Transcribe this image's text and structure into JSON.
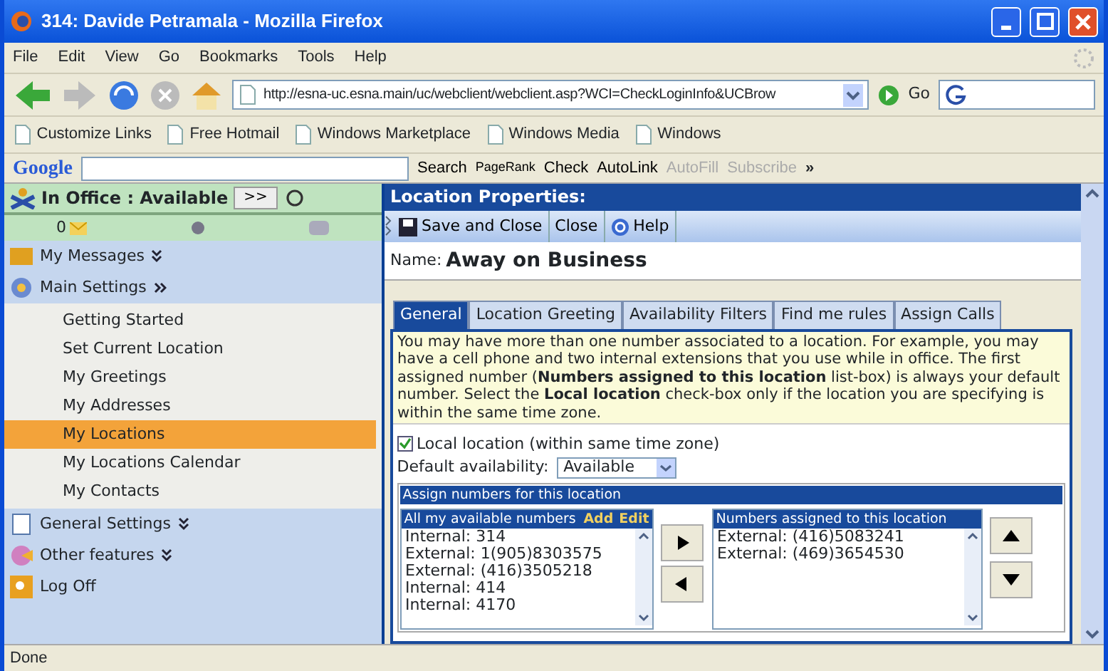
{
  "window": {
    "title": "314: Davide Petramala - Mozilla Firefox"
  },
  "menu": [
    "File",
    "Edit",
    "View",
    "Go",
    "Bookmarks",
    "Tools",
    "Help"
  ],
  "nav": {
    "url": "http://esna-uc.esna.main/uc/webclient/webclient.asp?WCI=CheckLoginInfo&UCBrow",
    "go": "Go"
  },
  "bookmarks": [
    "Customize Links",
    "Free Hotmail",
    "Windows Marketplace",
    "Windows Media",
    "Windows"
  ],
  "google_toolbar": {
    "logo": "Google",
    "items": [
      {
        "label": "Search",
        "disabled": false
      },
      {
        "label": "PageRank",
        "disabled": false
      },
      {
        "label": "Check",
        "disabled": false
      },
      {
        "label": "AutoLink",
        "disabled": false
      },
      {
        "label": "AutoFill",
        "disabled": true
      },
      {
        "label": "Subscribe",
        "disabled": true
      }
    ],
    "more": "»"
  },
  "sidebar": {
    "status": "In Office : Available",
    "status_button": ">>",
    "message_count": "0",
    "sections": [
      {
        "label": "My Messages",
        "expanded": false
      },
      {
        "label": "Main Settings",
        "expanded": true,
        "children": [
          {
            "label": "Getting Started",
            "selected": false
          },
          {
            "label": "Set Current Location",
            "selected": false
          },
          {
            "label": "My Greetings",
            "selected": false
          },
          {
            "label": "My Addresses",
            "selected": false
          },
          {
            "label": "My Locations",
            "selected": true
          },
          {
            "label": "My Locations Calendar",
            "selected": false
          },
          {
            "label": "My Contacts",
            "selected": false
          }
        ]
      },
      {
        "label": "General Settings",
        "expanded": false
      },
      {
        "label": "Other features",
        "expanded": false
      },
      {
        "label": "Log Off"
      }
    ]
  },
  "main": {
    "header": "Location Properties:",
    "toolbar": [
      "Save and Close",
      "Close",
      "Help"
    ],
    "name_label": "Name:",
    "name": "Away on Business",
    "tabs": [
      {
        "label": "General",
        "selected": true
      },
      {
        "label": "Location Greeting",
        "selected": false
      },
      {
        "label": "Availability Filters",
        "selected": false
      },
      {
        "label": "Find me rules",
        "selected": false
      },
      {
        "label": "Assign Calls",
        "selected": false
      }
    ],
    "info": "You may have more than one number associated to a location. For example, you may have a cell phone and two internal extensions that you use while in office. The first assigned number (**Numbers assigned to this location** list-box) is always your default number. Select the **Local location** check-box only if the location you are specifying is within the same time zone.",
    "local_location": {
      "label": "Local location (within same time zone)",
      "checked": true
    },
    "default_availability": {
      "label": "Default availability:",
      "value": "Available"
    },
    "assign": {
      "title": "Assign numbers for this location",
      "available": {
        "header": "All my available numbers",
        "links": [
          "Add",
          "Edit"
        ],
        "items": [
          "Internal: 314",
          "External: 1(905)8303575",
          "External: (416)3505218",
          "Internal: 414",
          "Internal: 4170"
        ]
      },
      "assigned": {
        "header": "Numbers assigned to this location",
        "items": [
          "External: (416)5083241",
          "External: (469)3654530"
        ]
      }
    }
  },
  "status_bar": "Done"
}
